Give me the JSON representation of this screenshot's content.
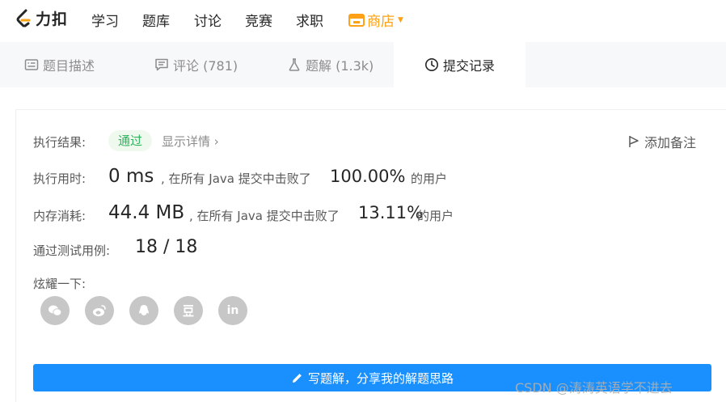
{
  "nav": {
    "logo_text": "力扣",
    "items": [
      "学习",
      "题库",
      "讨论",
      "竞赛",
      "求职"
    ],
    "shop_label": "商店",
    "accent": "#ffa116"
  },
  "tabs": [
    {
      "label": "题目描述",
      "icon": "description-icon",
      "active": false
    },
    {
      "label": "评论 (781)",
      "icon": "comment-icon",
      "active": false
    },
    {
      "label": "题解 (1.3k)",
      "icon": "flask-icon",
      "active": false
    },
    {
      "label": "提交记录",
      "icon": "clock-icon",
      "active": true
    }
  ],
  "result": {
    "result_label": "执行结果:",
    "result_value": "通过",
    "result_color": "#2db55d",
    "detail_link": "显示详情",
    "add_note": "添加备注",
    "runtime_label": "执行用时:",
    "runtime_value": "0 ms",
    "runtime_mid": ", 在所有 Java 提交中击败了",
    "runtime_pct": "100.00%",
    "users_suffix": "的用户",
    "memory_label": "内存消耗:",
    "memory_value": "44.4 MB",
    "memory_mid": ", 在所有 Java 提交中击败了",
    "memory_pct": "13.11%",
    "cases_label": "通过测试用例:",
    "cases_value": "18 / 18",
    "share_label": "炫耀一下:",
    "share_icons": [
      "wechat-icon",
      "weibo-icon",
      "qq-icon",
      "douban-icon",
      "linkedin-icon"
    ],
    "linkedin_text": "in",
    "write_button": "写题解，分享我的解题思路",
    "button_color": "#1a90ff"
  },
  "watermark": "CSDN @涛涛英语学不进去"
}
